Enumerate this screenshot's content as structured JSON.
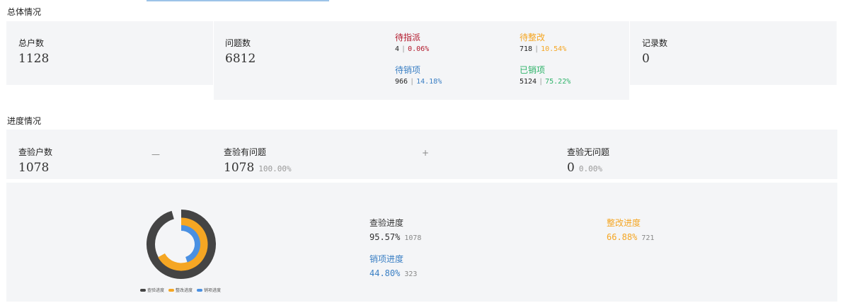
{
  "colors": {
    "assign": "#b2182b",
    "rectify": "#f5a623",
    "cancel": "#3a7fc4",
    "cancelled": "#2fb36a",
    "check_ring": "#444444",
    "rectify_ring": "#f5a623",
    "cancel_ring": "#4a90e2",
    "ring_bg": "#e9eaec"
  },
  "overall": {
    "title": "总体情况",
    "households": {
      "label": "总户数",
      "value": "1128"
    },
    "issues": {
      "label": "问题数",
      "value": "6812",
      "pending_assign": {
        "label": "待指派",
        "count": "4",
        "pct": "0.06%"
      },
      "pending_rectify": {
        "label": "待整改",
        "count": "718",
        "pct": "10.54%"
      },
      "pending_cancel": {
        "label": "待销项",
        "count": "966",
        "pct": "14.18%"
      },
      "cancelled": {
        "label": "已销项",
        "count": "5124",
        "pct": "75.22%"
      }
    },
    "records": {
      "label": "记录数",
      "value": "0"
    }
  },
  "progress": {
    "title": "进度情况",
    "checked_households": {
      "label": "查验户数",
      "value": "1078"
    },
    "minus_sign": "—",
    "plus_sign": "+",
    "with_issues": {
      "label": "查验有问题",
      "value": "1078",
      "pct": "100.00%"
    },
    "no_issues": {
      "label": "查验无问题",
      "value": "0",
      "pct": "0.00%"
    },
    "check_progress": {
      "label": "查验进度",
      "pct": "95.57%",
      "count": "1078",
      "fraction": 0.9557
    },
    "rectify_progress": {
      "label": "整改进度",
      "pct": "66.88%",
      "count": "721",
      "fraction": 0.6688
    },
    "cancel_progress": {
      "label": "销项进度",
      "pct": "44.80%",
      "count": "323",
      "fraction": 0.448
    },
    "legend": [
      "查验进度",
      "整改进度",
      "销项进度"
    ]
  }
}
